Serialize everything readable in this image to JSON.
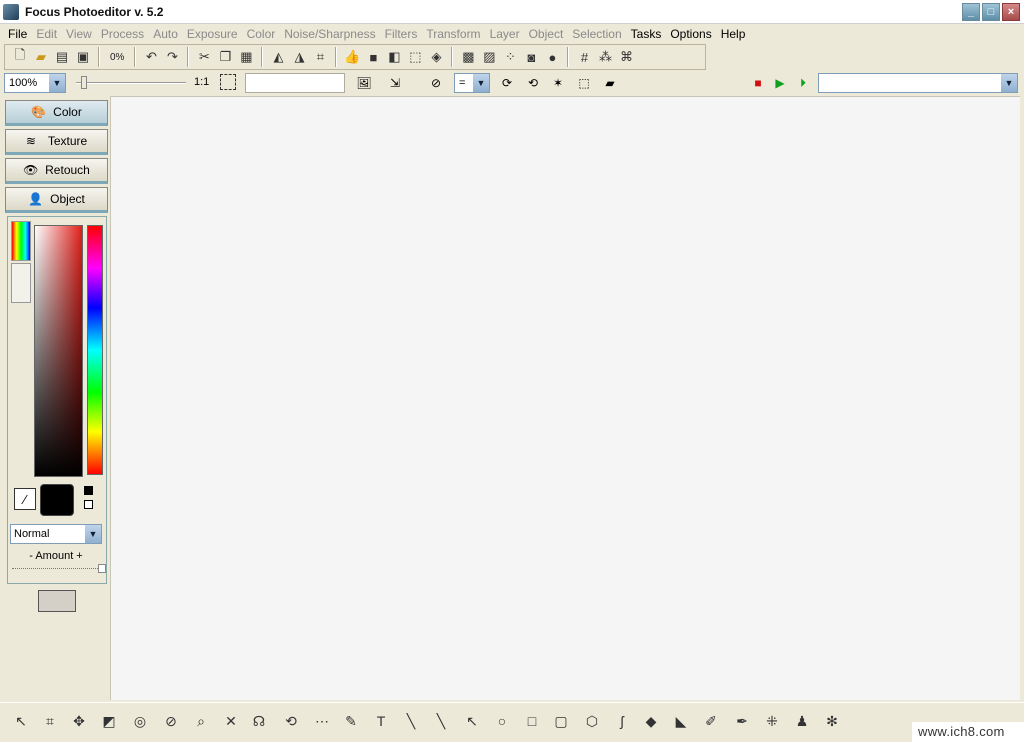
{
  "window": {
    "title": "Focus Photoeditor v. 5.2"
  },
  "menu": {
    "items": [
      {
        "label": "File",
        "enabled": true
      },
      {
        "label": "Edit",
        "enabled": false
      },
      {
        "label": "View",
        "enabled": false
      },
      {
        "label": "Process",
        "enabled": false
      },
      {
        "label": "Auto",
        "enabled": false
      },
      {
        "label": "Exposure",
        "enabled": false
      },
      {
        "label": "Color",
        "enabled": false
      },
      {
        "label": "Noise/Sharpness",
        "enabled": false
      },
      {
        "label": "Filters",
        "enabled": false
      },
      {
        "label": "Transform",
        "enabled": false
      },
      {
        "label": "Layer",
        "enabled": false
      },
      {
        "label": "Object",
        "enabled": false
      },
      {
        "label": "Selection",
        "enabled": false
      },
      {
        "label": "Tasks",
        "enabled": true
      },
      {
        "label": "Options",
        "enabled": true
      },
      {
        "label": "Help",
        "enabled": true
      }
    ]
  },
  "toolbar": {
    "percent_label": "0%",
    "zoom_value": "100%",
    "one_to_one": "1:1",
    "compare_value": "="
  },
  "left_panel": {
    "tabs": [
      {
        "label": "Color",
        "icon": "palette-icon"
      },
      {
        "label": "Texture",
        "icon": "texture-icon"
      },
      {
        "label": "Retouch",
        "icon": "eye-icon"
      },
      {
        "label": "Object",
        "icon": "object-icon"
      }
    ],
    "blend_mode": "Normal",
    "amount_label": "- Amount +",
    "foreground_color": "#000000"
  },
  "watermark": "www.ich8.com"
}
